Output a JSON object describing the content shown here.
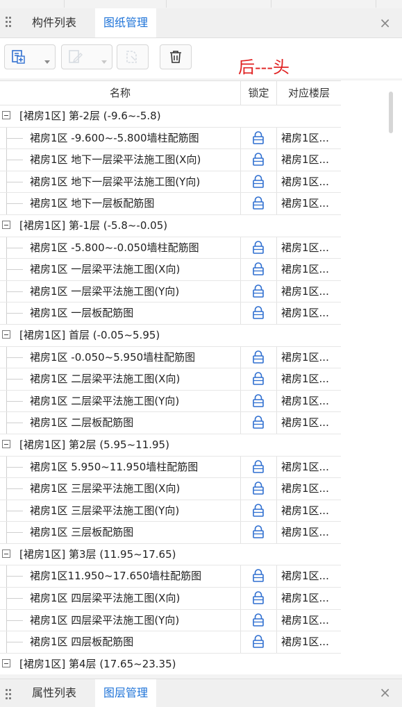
{
  "top_tabs": [
    {
      "label": "构件列表",
      "active": false
    },
    {
      "label": "图纸管理",
      "active": true
    }
  ],
  "bottom_tabs": [
    {
      "label": "属性列表",
      "active": false
    },
    {
      "label": "图层管理",
      "active": true
    }
  ],
  "close_glyph": "×",
  "annotation": "后---头",
  "columns": {
    "name": "名称",
    "lock": "锁定",
    "floor": "对应楼层"
  },
  "groups": [
    {
      "label": "[裙房1区] 第-2层 (-9.6~-5.8)",
      "items": [
        {
          "name": "裙房1区 -9.600~-5.800墙柱配筋图",
          "floor": "裙房1区..."
        },
        {
          "name": "裙房1区 地下一层梁平法施工图(X向)",
          "floor": "裙房1区..."
        },
        {
          "name": "裙房1区 地下一层梁平法施工图(Y向)",
          "floor": "裙房1区..."
        },
        {
          "name": "裙房1区 地下一层板配筋图",
          "floor": "裙房1区..."
        }
      ]
    },
    {
      "label": "[裙房1区] 第-1层 (-5.8~-0.05)",
      "items": [
        {
          "name": "裙房1区 -5.800~-0.050墙柱配筋图",
          "floor": "裙房1区..."
        },
        {
          "name": "裙房1区 一层梁平法施工图(X向)",
          "floor": "裙房1区..."
        },
        {
          "name": "裙房1区 一层梁平法施工图(Y向)",
          "floor": "裙房1区..."
        },
        {
          "name": "裙房1区 一层板配筋图",
          "floor": "裙房1区..."
        }
      ]
    },
    {
      "label": "[裙房1区] 首层 (-0.05~5.95)",
      "items": [
        {
          "name": "裙房1区 -0.050~5.950墙柱配筋图",
          "floor": "裙房1区..."
        },
        {
          "name": "裙房1区 二层梁平法施工图(X向)",
          "floor": "裙房1区..."
        },
        {
          "name": "裙房1区 二层梁平法施工图(Y向)",
          "floor": "裙房1区..."
        },
        {
          "name": "裙房1区 二层板配筋图",
          "floor": "裙房1区..."
        }
      ]
    },
    {
      "label": "[裙房1区] 第2层 (5.95~11.95)",
      "items": [
        {
          "name": "裙房1区 5.950~11.950墙柱配筋图",
          "floor": "裙房1区..."
        },
        {
          "name": "裙房1区 三层梁平法施工图(X向)",
          "floor": "裙房1区..."
        },
        {
          "name": "裙房1区 三层梁平法施工图(Y向)",
          "floor": "裙房1区..."
        },
        {
          "name": "裙房1区 三层板配筋图",
          "floor": "裙房1区..."
        }
      ]
    },
    {
      "label": "[裙房1区] 第3层 (11.95~17.65)",
      "items": [
        {
          "name": "裙房1区11.950~17.650墙柱配筋图",
          "floor": "裙房1区..."
        },
        {
          "name": "裙房1区 四层梁平法施工图(X向)",
          "floor": "裙房1区..."
        },
        {
          "name": "裙房1区 四层梁平法施工图(Y向)",
          "floor": "裙房1区..."
        },
        {
          "name": "裙房1区 四层板配筋图",
          "floor": "裙房1区..."
        }
      ]
    },
    {
      "label": "[裙房1区] 第4层 (17.65~23.35)",
      "items": []
    }
  ],
  "colors": {
    "accent": "#1e73d8",
    "annotation": "#e02222",
    "lock": "#2f6fd0"
  },
  "icons": [
    "add-drawing-icon",
    "edit-drawing-icon",
    "split-drawing-icon",
    "delete-icon",
    "lock-icon"
  ]
}
